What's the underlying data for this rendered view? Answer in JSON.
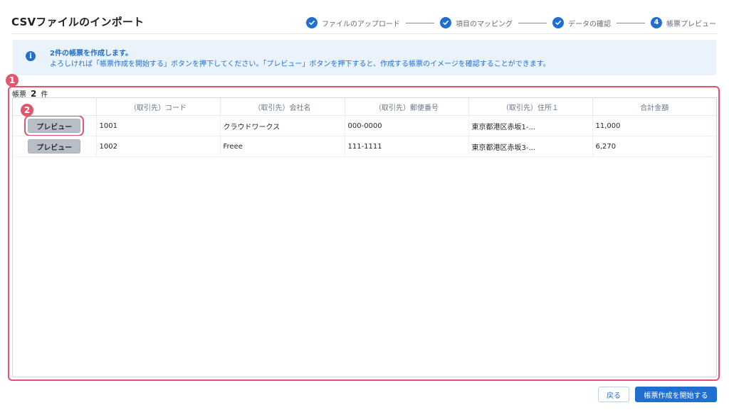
{
  "page": {
    "title": "CSVファイルのインポート"
  },
  "stepper": {
    "steps": [
      {
        "label": "ファイルのアップロード",
        "state": "done",
        "icon": "check-icon"
      },
      {
        "label": "項目のマッピング",
        "state": "done",
        "icon": "check-icon"
      },
      {
        "label": "データの確認",
        "state": "done",
        "icon": "check-icon"
      },
      {
        "label": "帳票プレビュー",
        "state": "current",
        "number": "4"
      }
    ]
  },
  "info": {
    "icon": "info-icon",
    "title": "2件の帳票を作成します。",
    "text": "よろしければ「帳票作成を開始する」ボタンを押下してください。「プレビュー」ボタンを押下すると、作成する帳票のイメージを確認することができます。"
  },
  "annotations": {
    "badge_1": "1",
    "badge_2": "2"
  },
  "summary": {
    "prefix": "帳票",
    "count": "2",
    "suffix": "件"
  },
  "table": {
    "headers": [
      "",
      "（取引先）コード",
      "（取引先）会社名",
      "（取引先）郵便番号",
      "（取引先）住所１",
      "合計金額"
    ],
    "rows": [
      {
        "button": "プレビュー",
        "code": "1001",
        "company": "クラウドワークス",
        "postal": "000-0000",
        "address": "東京都港区赤坂1-...",
        "total": "11,000"
      },
      {
        "button": "プレビュー",
        "code": "1002",
        "company": "Freee",
        "postal": "111-1111",
        "address": "東京都港区赤坂3-...",
        "total": "6,270"
      }
    ]
  },
  "actions": {
    "back": "戻る",
    "start": "帳票作成を開始する"
  },
  "colors": {
    "accent": "#1f6fd1",
    "highlight": "#e0566d",
    "info_bg": "#eaf3fb",
    "button_gray": "#b8bec6"
  }
}
